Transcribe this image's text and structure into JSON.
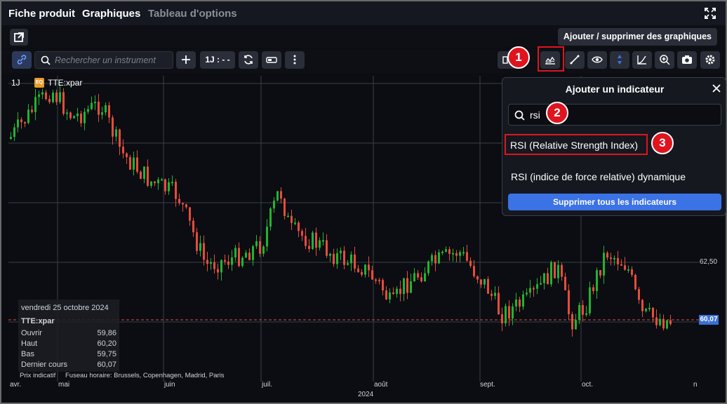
{
  "tabs": [
    {
      "label": "Fiche produit",
      "active": true
    },
    {
      "label": "Graphiques",
      "active": true
    },
    {
      "label": "Tableau d'options",
      "active": false
    }
  ],
  "header": {
    "add_charts_label": "Ajouter / supprimer des graphiques"
  },
  "toolbar": {
    "search_placeholder": "Rechercher un instrument",
    "resolution_label": "1J : - -"
  },
  "chart": {
    "period": "1J",
    "badge": "EQ",
    "symbol": "TTE:xpar",
    "price_labels": [
      "62,50"
    ],
    "last_price": "60,07",
    "time_labels": [
      "avr.",
      "mai",
      "juin",
      "juil.",
      "août",
      "sept.",
      "oct.",
      "n"
    ],
    "year": "2024",
    "footnote_left": "Prix indicatif",
    "footnote_right": "Fuseau horaire: Brussels, Copenhagen, Madrid, Paris"
  },
  "info": {
    "date": "vendredi 25 octobre 2024",
    "symbol": "TTE:xpar",
    "rows": [
      {
        "label": "Ouvrir",
        "value": "59,86"
      },
      {
        "label": "Haut",
        "value": "60,20"
      },
      {
        "label": "Bas",
        "value": "59,75"
      },
      {
        "label": "Dernier cours",
        "value": "60,07"
      }
    ]
  },
  "popup": {
    "title": "Ajouter un indicateur",
    "search_value": "rsi",
    "results": [
      "RSI (Relative Strength Index)",
      "RSI (indice de force relative) dynamique"
    ],
    "delete_label": "Supprimer tous les indicateurs"
  },
  "steps": [
    "1",
    "2",
    "3"
  ],
  "colors": {
    "up": "#1fb52f",
    "down": "#e74c3c",
    "accent": "#3b72e6",
    "highlight": "#e0141e"
  }
}
